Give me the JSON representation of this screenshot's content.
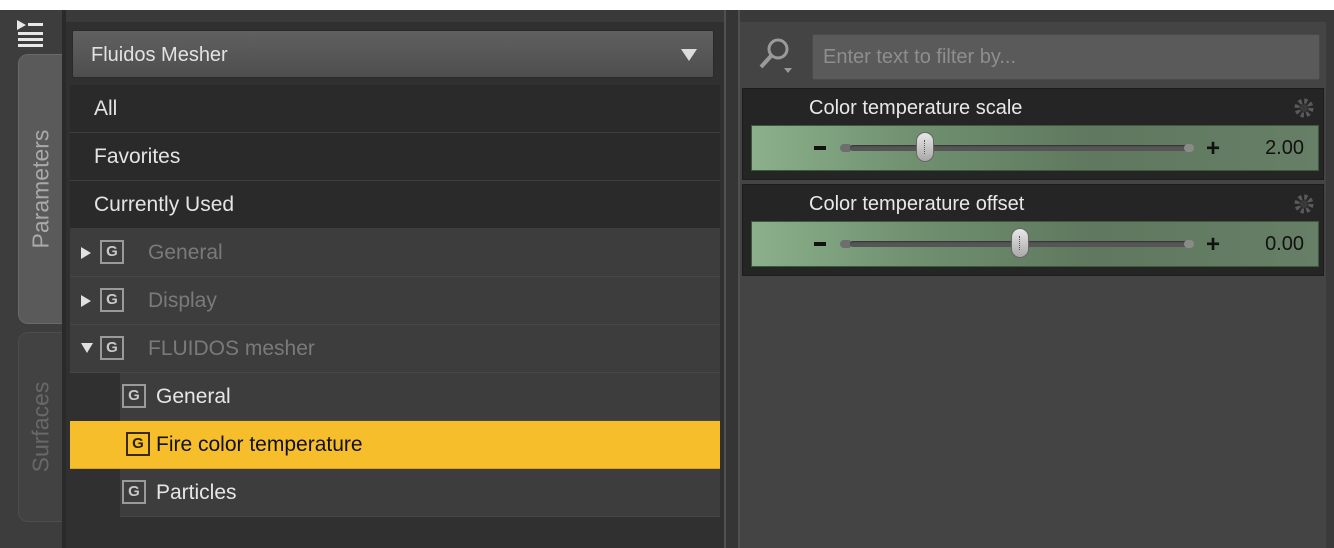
{
  "tabs": {
    "parameters": "Parameters",
    "surfaces": "Surfaces"
  },
  "left_panel": {
    "preset": "Fluidos Mesher",
    "rows": {
      "all": "All",
      "favorites": "Favorites",
      "currently_used": "Currently Used"
    },
    "group_icon_letter": "G",
    "groups": [
      {
        "label": "General",
        "expanded": false
      },
      {
        "label": "Display",
        "expanded": false
      },
      {
        "label": "FLUIDOS mesher",
        "expanded": true
      }
    ],
    "subgroups": [
      {
        "label": "General",
        "selected": false
      },
      {
        "label": "Fire color temperature",
        "selected": true
      },
      {
        "label": "Particles",
        "selected": false
      }
    ]
  },
  "right_panel": {
    "filter_placeholder": "Enter text to filter by...",
    "params": [
      {
        "label": "Color temperature scale",
        "value": "2.00",
        "slider_position": 0.22
      },
      {
        "label": "Color temperature offset",
        "value": "0.00",
        "slider_position": 0.5
      }
    ]
  },
  "colors": {
    "selection": "#f6be2b",
    "slider_bg": "#6f8f6f",
    "panel_bg": "#3a3a3a"
  },
  "icons": {
    "menu": "pane-menu-icon",
    "search": "magnifier-icon",
    "gear": "gear-icon",
    "expand": "triangle-right-icon",
    "collapse": "triangle-down-icon",
    "dropdown": "triangle-down-icon"
  }
}
